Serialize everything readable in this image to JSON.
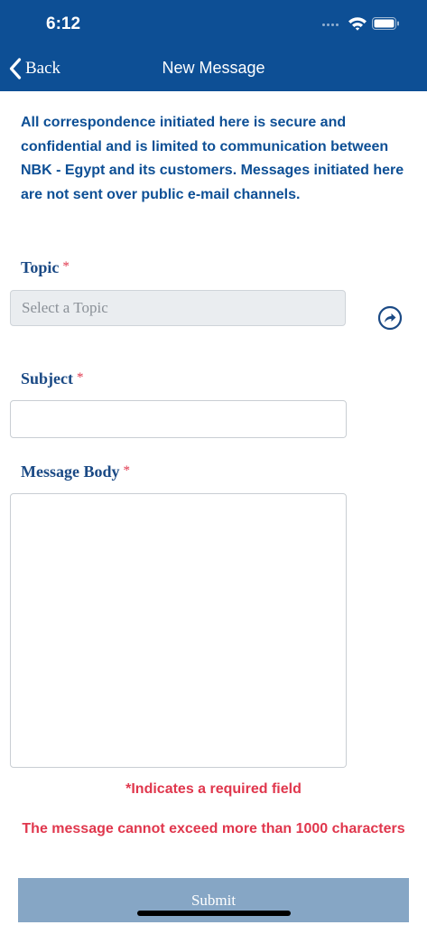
{
  "status_bar": {
    "time": "6:12"
  },
  "nav": {
    "back_label": "Back",
    "title": "New Message"
  },
  "intro_text": "All correspondence initiated here is secure and confidential and is limited to communication between NBK - Egypt and its customers. Messages initiated here are not sent over public e-mail channels.",
  "form": {
    "topic_label": "Topic",
    "topic_placeholder": "Select a Topic",
    "subject_label": "Subject",
    "subject_value": "",
    "message_body_label": "Message Body",
    "message_body_value": "",
    "required_marker": "*"
  },
  "notes": {
    "required_field": "*Indicates a required field",
    "char_limit": "The message cannot exceed more than 1000 characters"
  },
  "submit_label": "Submit",
  "colors": {
    "brand_blue": "#0d4f95",
    "label_blue": "#1b4a85",
    "required_red": "#e0374d",
    "submit_disabled": "#86a6c5",
    "select_bg": "#eaedf0"
  },
  "icons": {
    "back": "chevron-left-icon",
    "topic_action": "share-arrow-icon",
    "wifi": "wifi-icon",
    "battery": "battery-icon",
    "signal": "signal-icon"
  }
}
